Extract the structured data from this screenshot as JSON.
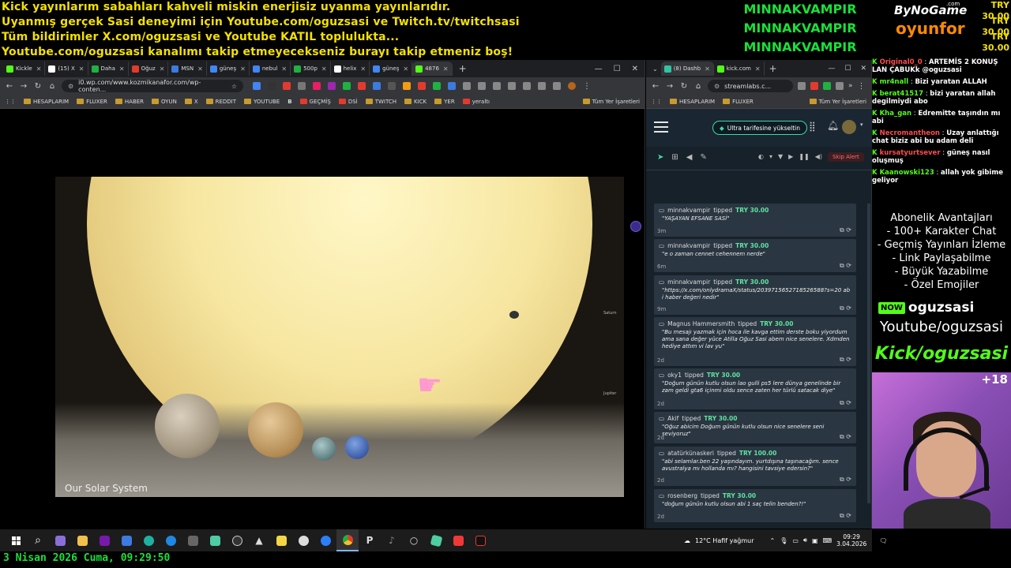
{
  "banner": {
    "lines": [
      "Kick yayınlarım sabahları kahveli miskin enerjisiz uyanma yayınlarıdır.",
      "Uyanmış gerçek Sasi deneyimi için Youtube.com/oguzsasi ve Twitch.tv/twitchsasi",
      "Tüm bildirimler X.com/oguzsasi ve Youtube KATIL topluluktа...",
      "Youtube.com/oguzsasi kanalımı takip etmeyecekseniz burayı takip etmeniz boş!"
    ],
    "top_tippers": [
      "MINNAKVAMPIR",
      "MINNAKVAMPIR",
      "MINNAKVAMPIR"
    ],
    "logo_top": "ByNoGame",
    "logo_com": ".com",
    "logo_bottom": "oyunfor",
    "amounts": [
      "TRY 30.00",
      "TRY 30.00",
      "TRY 30.00"
    ]
  },
  "browser_left": {
    "tabs": [
      {
        "label": "Kickle",
        "color": "#53fc18"
      },
      {
        "label": "(15) X",
        "color": "#ffffff"
      },
      {
        "label": "Daha",
        "color": "#1fb141"
      },
      {
        "label": "Oğuz",
        "color": "#e23b2e"
      },
      {
        "label": "MSN",
        "color": "#3c7be0"
      },
      {
        "label": "güneş",
        "color": "#4285f4"
      },
      {
        "label": "nebul",
        "color": "#4285f4"
      },
      {
        "label": "500p",
        "color": "#1fb141"
      },
      {
        "label": "helix",
        "color": "#ffffff"
      },
      {
        "label": "güneş",
        "color": "#4285f4"
      },
      {
        "label": "4876",
        "color": "#53fc18"
      }
    ],
    "url": "i0.wp.com/www.kozmikanafor.com/wp-conten...",
    "bookmarks": [
      "HESAPLARIM",
      "FLUXER",
      "HABER",
      "OYUN",
      "X",
      "REDDIT",
      "YOUTUBE",
      "B",
      "GEÇMİŞ",
      "DSİ",
      "TWITCH",
      "KICK",
      "YER",
      "yeraltı"
    ],
    "bookmarks_all": "Tüm Yer İşaretleri",
    "image_caption": "Our Solar System",
    "image_labels": [
      "Saturn",
      "Jupiter"
    ]
  },
  "browser_right": {
    "tabs": [
      {
        "label": "(8) Dashb",
        "color": "#31c4a4"
      },
      {
        "label": "kick.com",
        "color": "#53fc18"
      }
    ],
    "url": "streamlabs.c...",
    "bookmarks": [
      "HESAPLARIM",
      "FLUXER"
    ],
    "bookmarks_all": "Tüm Yer İşaretleri",
    "upgrade_label": "Ultra tarifesine yükseltin",
    "skip_label": "Skip Alert",
    "alerts": [
      {
        "user": "minnakvampir",
        "verb": "tipped",
        "amount": "TRY 30.00",
        "message": "\"YAŞAYAN EFSANE SASİ\"",
        "time": "3m"
      },
      {
        "user": "minnakvampir",
        "verb": "tipped",
        "amount": "TRY 30.00",
        "message": "\"e o zaman cennet cehennem nerde\"",
        "time": "6m"
      },
      {
        "user": "minnakvampir",
        "verb": "tipped",
        "amount": "TRY 30.00",
        "message": "\"https://x.com/onlydramaX/status/2039715652718526588?s=20 abi haber değeri nedir\"",
        "time": "9m"
      },
      {
        "user": "Magnus Hammersmith",
        "verb": "tipped",
        "amount": "TRY 30.00",
        "message": "\"Bu mesajı yazmak için hoca ile kavga ettim derste boku yiyordum ama sana değer yüce Atilla Oğuz Sasi abem nice senelere. Xdmden hediye attım vi lav yu\"",
        "time": "2d"
      },
      {
        "user": "oky1",
        "verb": "tipped",
        "amount": "TRY 30.00",
        "message": "\"Doğum günün kutlu olsun lao gulli ps5 lere dünya genelinde bir zam geldi gta6 içinmi oldu sence zaten her türlü satacak diye\"",
        "time": "2d"
      },
      {
        "user": "Akif",
        "verb": "tipped",
        "amount": "TRY 30.00",
        "message": "\"Oğuz abicim Doğum günün kutlu olsun nice senelere seni seviyoruz\"",
        "time": "2d"
      },
      {
        "user": "atatürkünaskeri",
        "verb": "tipped",
        "amount": "TRY 100.00",
        "message": "\"abi selamlar.ben 22 yaşındayım. yurtdışına taşınacağım. sence avustralya mı hollanda mı? hangisini tavsiye edersin?\"",
        "time": "2d"
      },
      {
        "user": "rosenberg",
        "verb": "tipped",
        "amount": "TRY 30.00",
        "message": "\"doğum günün kutlu olsun abi 1 saç telin benden?!\"",
        "time": "2d"
      }
    ]
  },
  "chat": [
    {
      "user": "Original0_0",
      "text": "ARTEMİS 2 KONUŞ LAN ÇABUKk @oguzsasi",
      "red": true
    },
    {
      "user": "mr4nall",
      "text": "Bizi yaratan ALLAH",
      "red": false
    },
    {
      "user": "berat41517",
      "text": "bizi yaratan allah degilmiydi abo",
      "red": false
    },
    {
      "user": "Kha_gan",
      "text": "Edremitte taşındın mı abi",
      "red": false
    },
    {
      "user": "Necromantheon",
      "text": "Uzay anlattığı chat biziz abi bu adam deli",
      "red": true
    },
    {
      "user": "kursatyurtsever",
      "text": "güneş nasıl oluşmuş",
      "red": true
    },
    {
      "user": "Kaanowski123",
      "text": "allah yok gibime geliyor",
      "red": false
    }
  ],
  "perks": {
    "title": "Abonelik Avantajları",
    "items": [
      "- 100+ Karakter Chat",
      "- Geçmiş Yayınları İzleme",
      "- Link Paylaşabilme",
      "- Büyük Yazabilme",
      "- Özel Emojiler"
    ]
  },
  "socials": {
    "now_badge": "NOW",
    "kick_name": "oguzsasi",
    "youtube": "Youtube/oguzsasi",
    "kick_big": "Kick/oguzsasi",
    "age": "+18"
  },
  "taskbar": {
    "weather": "12°C  Hafif yağmur",
    "time": "09:29",
    "date": "3.04.2026"
  },
  "bottom_date": "3 Nisan 2026 Cuma, 09:29:50"
}
